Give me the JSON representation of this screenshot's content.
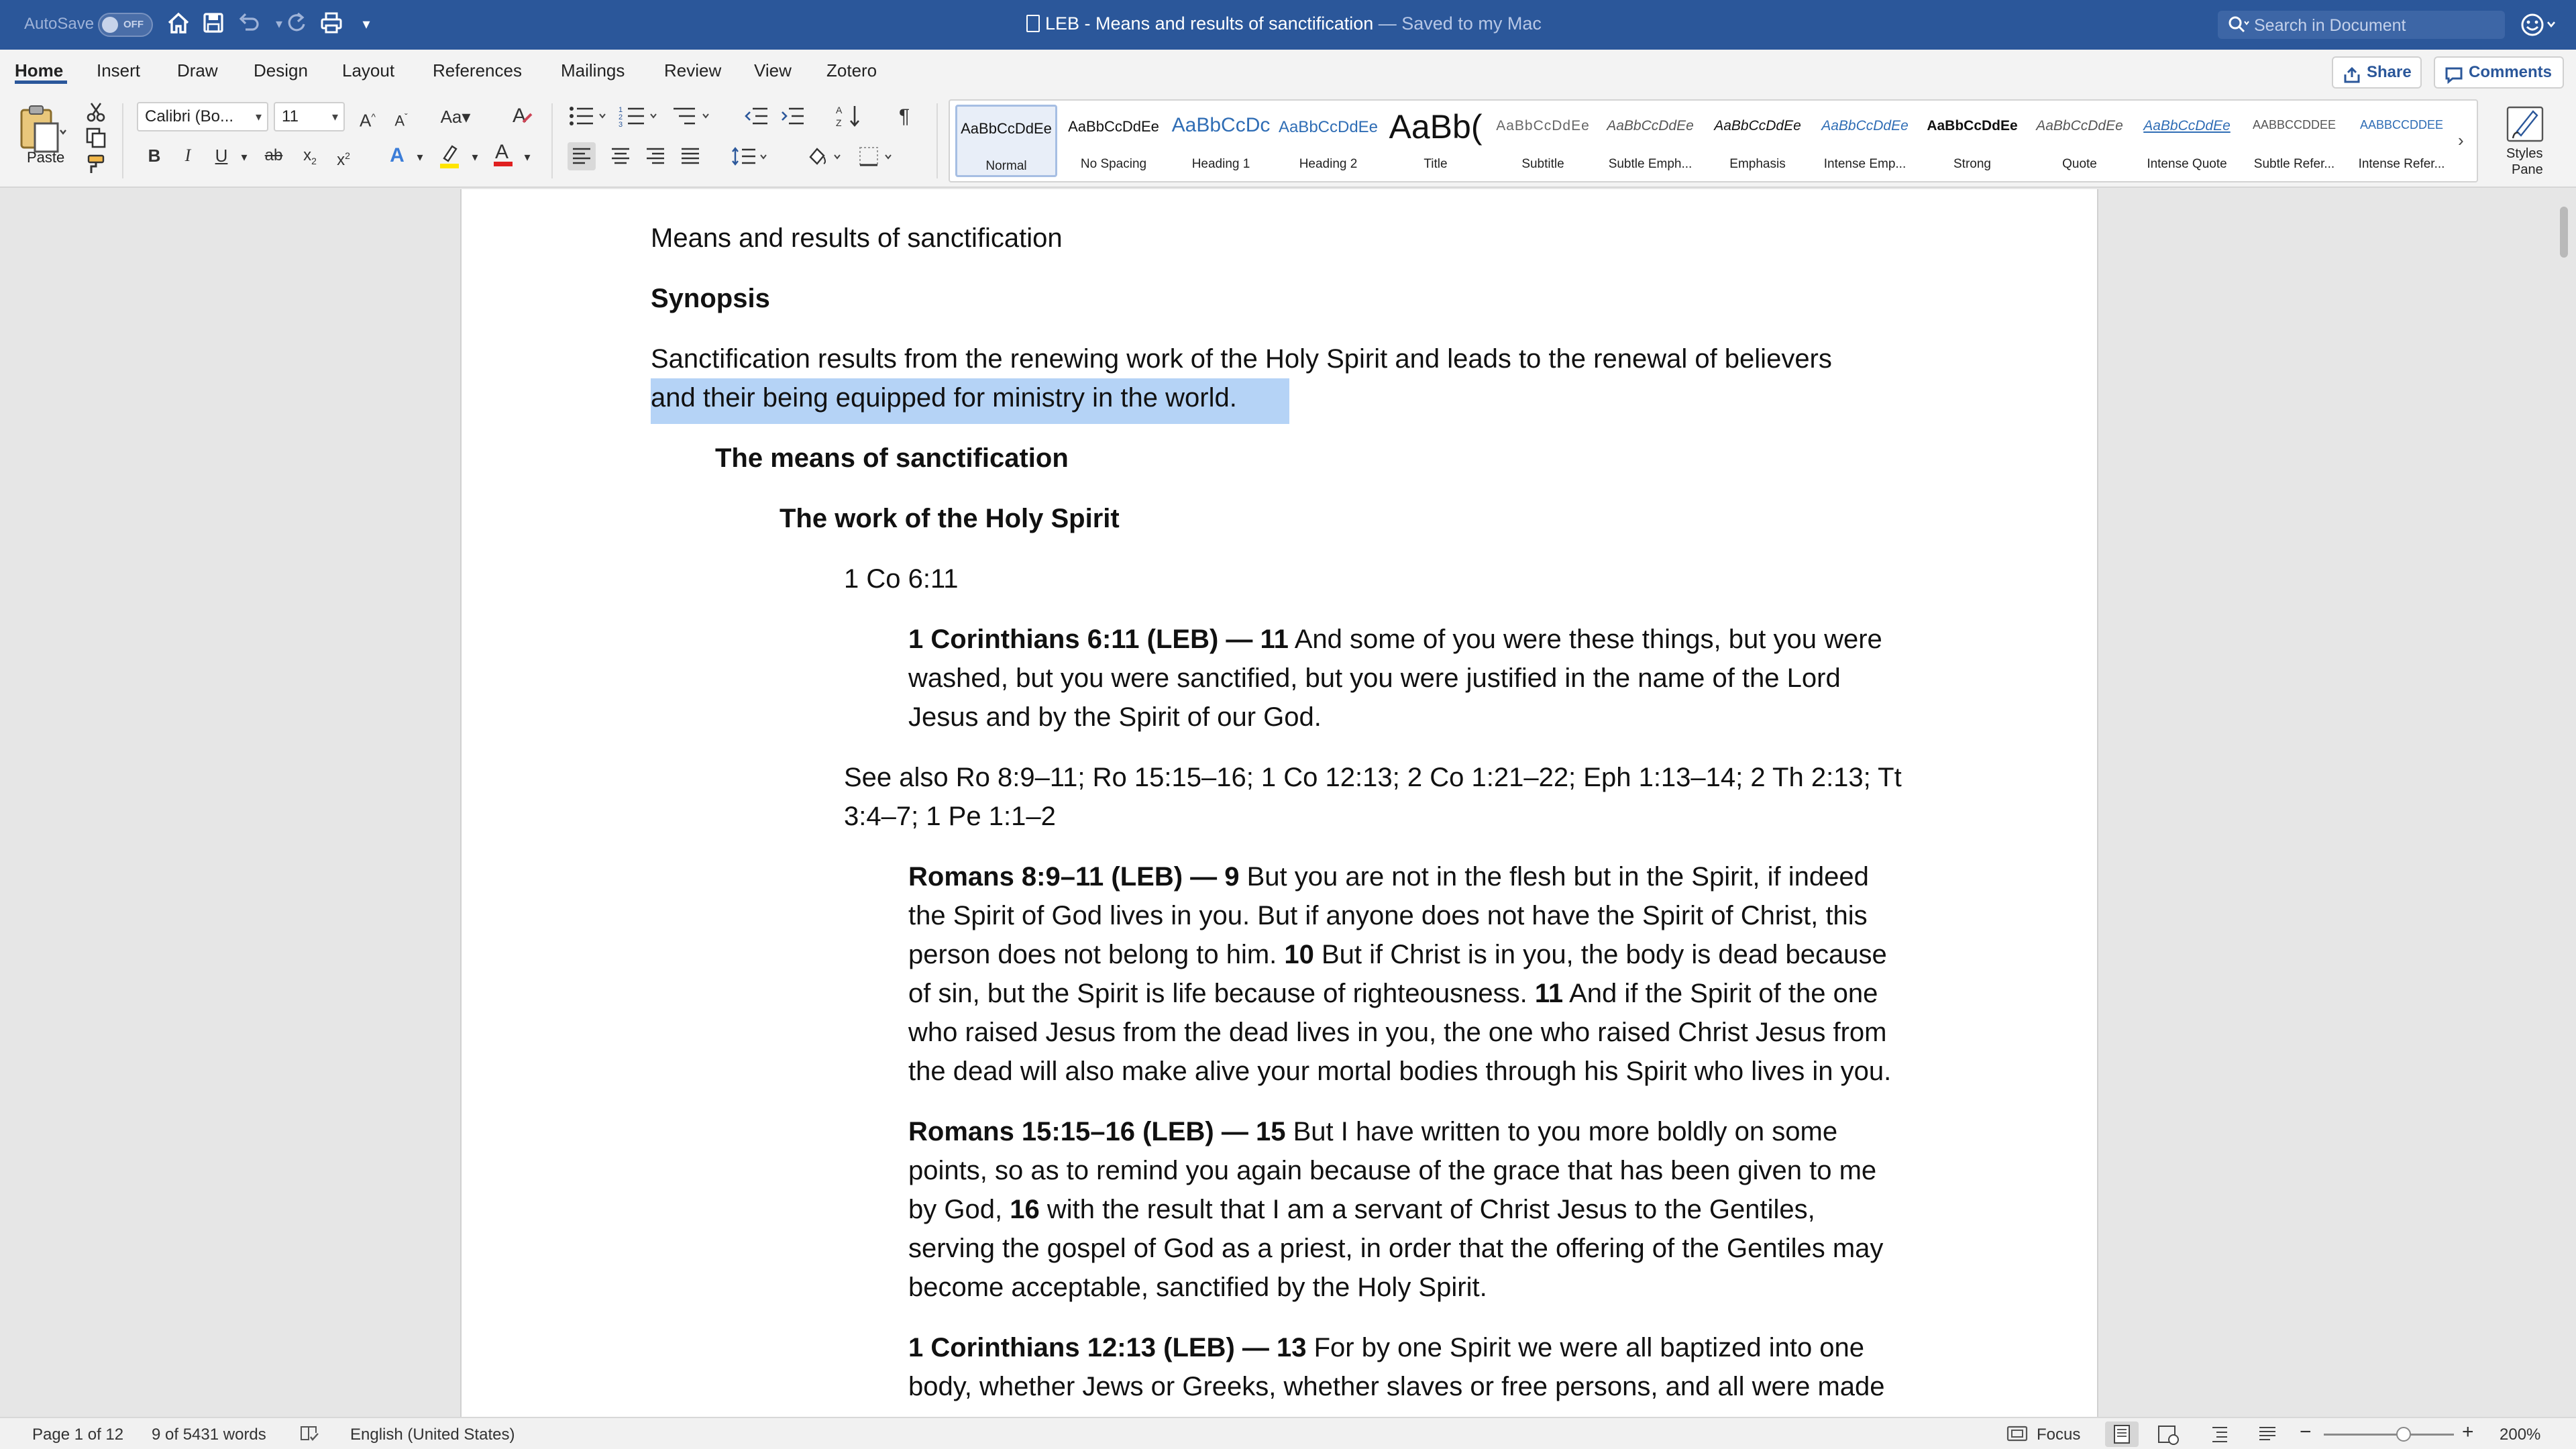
{
  "titlebar": {
    "autosave_label": "AutoSave",
    "autosave_state": "OFF",
    "doc_title": "LEB - Means and results of sanctification",
    "saved_status": "— Saved to my Mac",
    "search_placeholder": "Search in Document"
  },
  "ribbon_tabs": [
    "Home",
    "Insert",
    "Draw",
    "Design",
    "Layout",
    "References",
    "Mailings",
    "Review",
    "View",
    "Zotero"
  ],
  "actions": {
    "share": "Share",
    "comments": "Comments"
  },
  "ribbon": {
    "paste_label": "Paste",
    "font_name": "Calibri (Bo...",
    "font_size": "11",
    "styles_pane_line1": "Styles",
    "styles_pane_line2": "Pane",
    "style_sample_text": "AaBbCcDdEe",
    "styles": [
      {
        "sample": "AaBbCcDdEe",
        "name": "Normal"
      },
      {
        "sample": "AaBbCcDdEe",
        "name": "No Spacing"
      },
      {
        "sample": "AaBbCcDc",
        "name": "Heading 1"
      },
      {
        "sample": "AaBbCcDdEe",
        "name": "Heading 2"
      },
      {
        "sample": "AaBb(",
        "name": "Title"
      },
      {
        "sample": "AaBbCcDdEe",
        "name": "Subtitle"
      },
      {
        "sample": "AaBbCcDdEe",
        "name": "Subtle Emph..."
      },
      {
        "sample": "AaBbCcDdEe",
        "name": "Emphasis"
      },
      {
        "sample": "AaBbCcDdEe",
        "name": "Intense Emp..."
      },
      {
        "sample": "AaBbCcDdEe",
        "name": "Strong"
      },
      {
        "sample": "AaBbCcDdEe",
        "name": "Quote"
      },
      {
        "sample": "AaBbCcDdEe",
        "name": "Intense Quote"
      },
      {
        "sample": "AABBCCDDEE",
        "name": "Subtle Refer..."
      },
      {
        "sample": "AABBCCDDEE",
        "name": "Intense Refer..."
      }
    ]
  },
  "document": {
    "title": "Means and results of sanctification",
    "synopsis_heading": "Synopsis",
    "synopsis_line1": "Sanctification results from the renewing work of the Holy Spirit and leads to the renewal of believers",
    "synopsis_line2": "and their being equipped for ministry in the world.",
    "h1": "The means of sanctification",
    "h2": "The work of the Holy Spirit",
    "ref1": "1 Co 6:11",
    "q1": {
      "ref": "1 Corinthians 6:11 (LEB) — 11",
      "line1": " And some of you were these things, but you were",
      "line2": "washed, but you were sanctified, but you were justified in the name of the Lord",
      "line3": "Jesus and by the Spirit of our God."
    },
    "see_also_line1": "See also Ro 8:9–11; Ro 15:15–16; 1 Co 12:13; 2 Co 1:21–22; Eph 1:13–14; 2 Th 2:13; Tt",
    "see_also_line2": "3:4–7; 1 Pe 1:1–2",
    "q2": {
      "ref": "Romans 8:9–11 (LEB) — 9",
      "line1": " But you are not in the flesh but in the Spirit, if indeed",
      "line2": "the Spirit of God lives in you. But if anyone does not have the Spirit of Christ, this",
      "line3a": "person does not belong to him. ",
      "v10": "10",
      "line3b": " But if Christ is in you, the body is dead because",
      "line4a": "of sin, but the Spirit is life because of righteousness. ",
      "v11": "11",
      "line4b": " And if the Spirit of the one",
      "line5": "who raised Jesus from the dead lives in you, the one who raised Christ Jesus from",
      "line6": "the dead will also make alive your mortal bodies through his Spirit who lives in you."
    },
    "q3": {
      "ref": "Romans 15:15–16 (LEB) — 15",
      "line1": " But I have written to you more boldly on some",
      "line2": "points, so as to remind you again because of the grace that has been given to me",
      "line3a": "by God, ",
      "v16": "16",
      "line3b": " with the result that I am a servant of Christ Jesus to the Gentiles,",
      "line4": "serving the gospel of God as a priest, in order that the offering of the Gentiles may",
      "line5": "become acceptable, sanctified by the Holy Spirit."
    },
    "q4": {
      "ref": "1 Corinthians 12:13 (LEB) — 13",
      "line1": " For by one Spirit we were all baptized into one",
      "line2": "body, whether Jews or Greeks, whether slaves or free persons, and all were made"
    }
  },
  "statusbar": {
    "page": "Page 1 of 12",
    "words": "9 of 5431 words",
    "language": "English (United States)",
    "focus": "Focus",
    "zoom": "200%"
  },
  "colors": {
    "word_blue": "#2b579a",
    "selection": "#b5d3f6"
  }
}
